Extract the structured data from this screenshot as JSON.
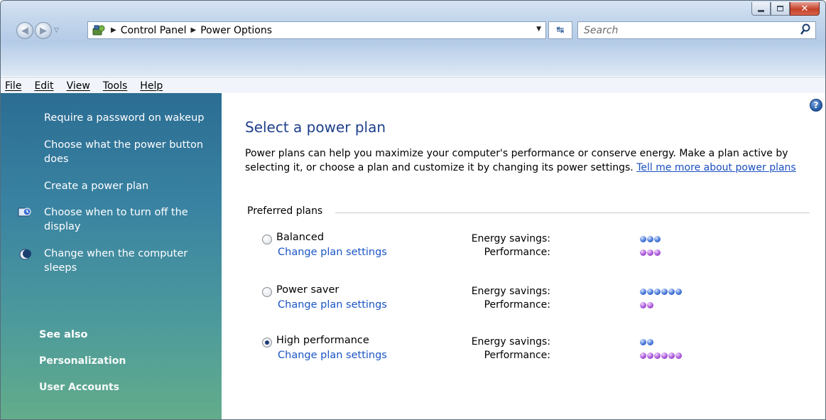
{
  "window": {
    "buttons": {
      "minimize": "minimize",
      "maximize": "maximize",
      "close": "close"
    }
  },
  "nav": {
    "breadcrumbs": [
      "Control Panel",
      "Power Options"
    ],
    "search_placeholder": "Search"
  },
  "menu": [
    "File",
    "Edit",
    "View",
    "Tools",
    "Help"
  ],
  "sidebar": {
    "tasks": [
      {
        "label": "Require a password on wakeup",
        "icon": null
      },
      {
        "label": "Choose what the power button does",
        "icon": null
      },
      {
        "label": "Create a power plan",
        "icon": null
      },
      {
        "label": "Choose when to turn off the display",
        "icon": "monitor-clock-icon"
      },
      {
        "label": "Change when the computer sleeps",
        "icon": "moon-icon"
      }
    ],
    "see_also_heading": "See also",
    "see_also": [
      "Personalization",
      "User Accounts"
    ]
  },
  "main": {
    "title": "Select a power plan",
    "intro": "Power plans can help you maximize your computer's performance or conserve energy. Make a plan active by selecting it, or choose a plan and customize it by changing its power settings.",
    "intro_link": "Tell me more about power plans",
    "group_label": "Preferred plans",
    "energy_label": "Energy savings:",
    "performance_label": "Performance:",
    "change_link": "Change plan settings",
    "plans": [
      {
        "name": "Balanced",
        "selected": false,
        "energy_savings": 3,
        "performance": 3
      },
      {
        "name": "Power saver",
        "selected": false,
        "energy_savings": 6,
        "performance": 2
      },
      {
        "name": "High performance",
        "selected": true,
        "energy_savings": 2,
        "performance": 6
      }
    ]
  },
  "colors": {
    "sidebar_top": "#2b6d93",
    "sidebar_bottom": "#63ad8a",
    "title": "#1e3f8a",
    "link": "#1a55c4",
    "energy_dot": "#3d6fd6",
    "performance_dot": "#a64fd6"
  }
}
